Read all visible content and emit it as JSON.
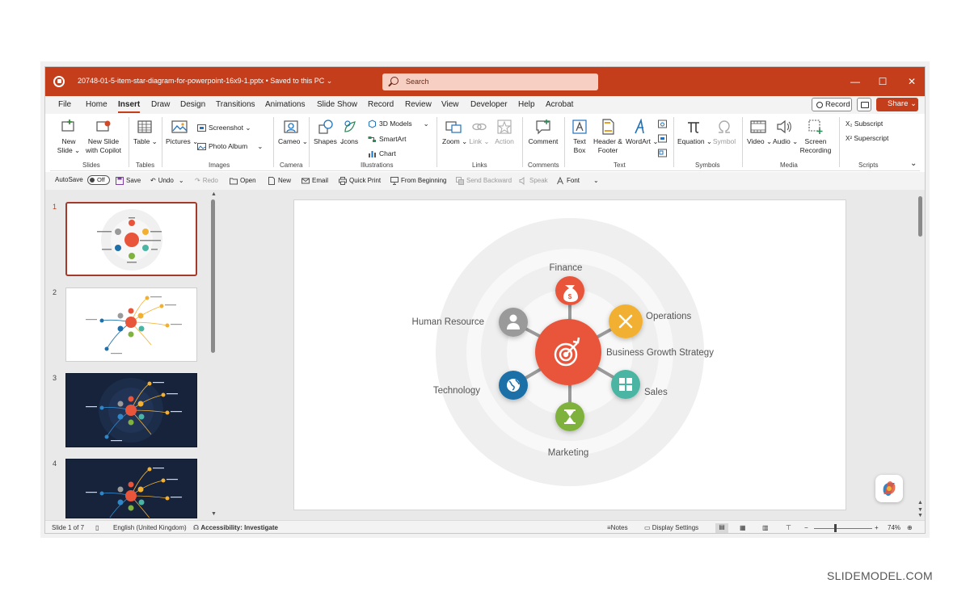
{
  "window": {
    "document_title": "20748-01-5-item-star-diagram-for-powerpoint-16x9-1.pptx  •  Saved to this PC ⌄",
    "search_placeholder": "Search"
  },
  "menu_tabs": [
    "File",
    "Home",
    "Insert",
    "Draw",
    "Design",
    "Transitions",
    "Animations",
    "Slide Show",
    "Record",
    "Review",
    "View",
    "Developer",
    "Help",
    "Acrobat"
  ],
  "menu_active": "Insert",
  "menu_right": {
    "record": "Record",
    "share": "Share ⌄"
  },
  "ribbon": {
    "new_slide": "New Slide ⌄",
    "new_slide_copilot": "New Slide with Copilot",
    "table": "Table ⌄",
    "pictures": "Pictures ⌄",
    "screenshot": "Screenshot ⌄",
    "photo_album": "Photo Album",
    "cameo": "Cameo ⌄",
    "shapes": "Shapes ⌄",
    "icons": "Icons",
    "models_3d": "3D Models",
    "smartart": "SmartArt",
    "chart": "Chart",
    "zoom": "Zoom ⌄",
    "link": "Link ⌄",
    "action": "Action",
    "comment": "Comment",
    "text_box": "Text Box",
    "header_footer": "Header & Footer",
    "wordart": "WordArt ⌄",
    "equation": "Equation ⌄",
    "symbol": "Symbol",
    "video": "Video ⌄",
    "audio": "Audio ⌄",
    "screen_recording": "Screen Recording",
    "subscript": "Subscript",
    "superscript": "Superscript",
    "groups": [
      "Slides",
      "Tables",
      "Images",
      "Camera",
      "Illustrations",
      "Links",
      "Comments",
      "Text",
      "Symbols",
      "Media",
      "Scripts"
    ]
  },
  "qat": {
    "autosave": "AutoSave",
    "autosave_state": "Off",
    "save": "Save",
    "undo": "Undo",
    "redo": "Redo",
    "open": "Open",
    "new": "New",
    "email": "Email",
    "quick_print": "Quick Print",
    "from_beginning": "From Beginning",
    "send_backward": "Send Backward",
    "speak": "Speak",
    "font": "Font"
  },
  "thumbnails": [
    {
      "number": "1",
      "theme": "light",
      "selected": true
    },
    {
      "number": "2",
      "theme": "light",
      "selected": false
    },
    {
      "number": "3",
      "theme": "dark",
      "selected": false
    },
    {
      "number": "4",
      "theme": "dark",
      "selected": false
    }
  ],
  "slide": {
    "center_label": "Business Growth Strategy",
    "nodes": [
      {
        "label": "Finance",
        "icon": "money-bag-icon",
        "color": "#e8553a"
      },
      {
        "label": "Operations",
        "icon": "tools-icon",
        "color": "#f2b033"
      },
      {
        "label": "Sales",
        "icon": "grid-icon",
        "color": "#4ab5a2"
      },
      {
        "label": "Marketing",
        "icon": "hourglass-icon",
        "color": "#7fb23e"
      },
      {
        "label": "Technology",
        "icon": "globe-icon",
        "color": "#1f6fa8"
      },
      {
        "label": "Human Resource",
        "icon": "person-icon",
        "color": "#9a9a9a"
      }
    ],
    "center_color": "#e8553a"
  },
  "status": {
    "slide_of": "Slide 1 of 7",
    "language": "English (United Kingdom)",
    "accessibility": "Accessibility: Investigate",
    "notes": "Notes",
    "display_settings": "Display Settings",
    "zoom": "74%"
  },
  "watermark": "SLIDEMODEL.COM"
}
